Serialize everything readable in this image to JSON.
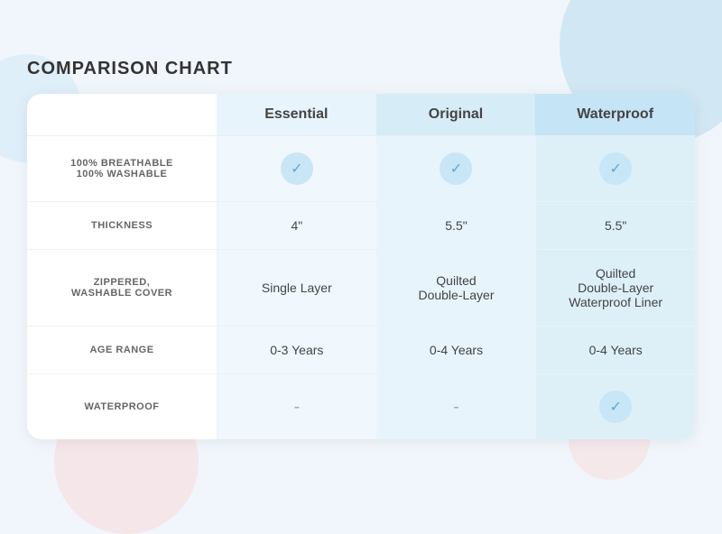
{
  "title": "COMPARISON CHART",
  "columns": [
    "Essential",
    "Original",
    "Waterproof"
  ],
  "rows": [
    {
      "label": "100% BREATHABLE\n100% WASHABLE",
      "essential": "check",
      "original": "check",
      "waterproof": "check"
    },
    {
      "label": "THICKNESS",
      "essential": "4\"",
      "original": "5.5\"",
      "waterproof": "5.5\""
    },
    {
      "label": "ZIPPERED,\nWASHABLE COVER",
      "essential": "Single Layer",
      "original": "Quilted\nDouble-Layer",
      "waterproof": "Quilted\nDouble-Layer\nWaterproof Liner"
    },
    {
      "label": "AGE RANGE",
      "essential": "0-3 Years",
      "original": "0-4 Years",
      "waterproof": "0-4 Years"
    },
    {
      "label": "WATERPROOF",
      "essential": "dash",
      "original": "dash",
      "waterproof": "check"
    }
  ],
  "check_symbol": "✓",
  "dash_symbol": "-"
}
